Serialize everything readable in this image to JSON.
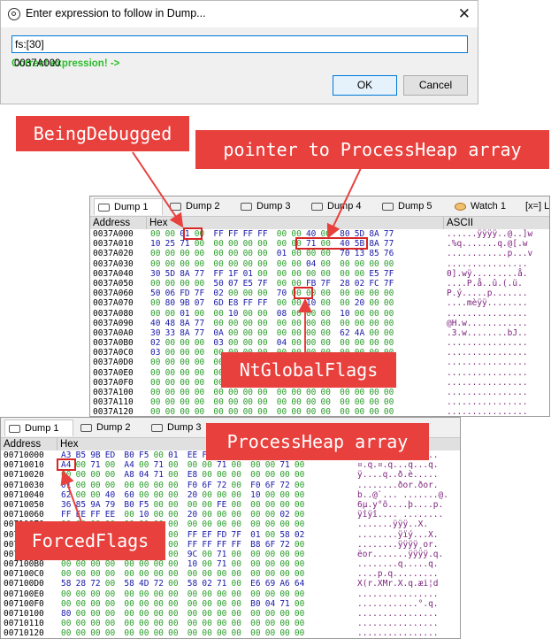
{
  "dialog": {
    "title": "Enter expression to follow in Dump...",
    "close_glyph": "✕",
    "expression_value": "fs:[30]",
    "status_ok": "Correct expression! ->",
    "status_address": "0037A000",
    "ok_label": "OK",
    "cancel_label": "Cancel"
  },
  "dump1": {
    "tabs": [
      "Dump 1",
      "Dump 2",
      "Dump 3",
      "Dump 4",
      "Dump 5",
      "Watch 1",
      "[x=] Lo"
    ],
    "headers": {
      "address": "Address",
      "hex": "Hex",
      "ascii": "ASCII"
    },
    "rows": [
      {
        "addr": "0037A000",
        "bytes": [
          "00",
          "00",
          "01",
          "00",
          "FF",
          "FF",
          "FF",
          "FF",
          "00",
          "00",
          "40",
          "00",
          "80",
          "5D",
          "8A",
          "77"
        ],
        "ascii": "......ÿÿÿÿ..@..]w"
      },
      {
        "addr": "0037A010",
        "bytes": [
          "10",
          "25",
          "71",
          "00",
          "00",
          "00",
          "00",
          "00",
          "00",
          "00",
          "71",
          "00",
          "40",
          "5B",
          "8A",
          "77"
        ],
        "ascii": ".%q.......q.@[.w"
      },
      {
        "addr": "0037A020",
        "bytes": [
          "00",
          "00",
          "00",
          "00",
          "00",
          "00",
          "00",
          "00",
          "01",
          "00",
          "00",
          "00",
          "70",
          "13",
          "85",
          "76"
        ],
        "ascii": "............p...v"
      },
      {
        "addr": "0037A030",
        "bytes": [
          "00",
          "00",
          "00",
          "00",
          "00",
          "00",
          "00",
          "00",
          "00",
          "00",
          "04",
          "00",
          "00",
          "00",
          "00",
          "00"
        ],
        "ascii": "................"
      },
      {
        "addr": "0037A040",
        "bytes": [
          "30",
          "5D",
          "8A",
          "77",
          "FF",
          "1F",
          "01",
          "00",
          "00",
          "00",
          "00",
          "00",
          "00",
          "00",
          "E5",
          "7F"
        ],
        "ascii": "0].wÿ.........å."
      },
      {
        "addr": "0037A050",
        "bytes": [
          "00",
          "00",
          "00",
          "00",
          "50",
          "07",
          "E5",
          "7F",
          "00",
          "00",
          "FB",
          "7F",
          "28",
          "02",
          "FC",
          "7F"
        ],
        "ascii": "....P.å..û.(.ü."
      },
      {
        "addr": "0037A060",
        "bytes": [
          "50",
          "06",
          "FD",
          "7F",
          "02",
          "00",
          "00",
          "00",
          "70",
          "00",
          "00",
          "00",
          "00",
          "00",
          "00",
          "00"
        ],
        "ascii": "P.ý.....p......."
      },
      {
        "addr": "0037A070",
        "bytes": [
          "00",
          "80",
          "9B",
          "07",
          "6D",
          "E8",
          "FF",
          "FF",
          "00",
          "00",
          "10",
          "00",
          "00",
          "20",
          "00",
          "00"
        ],
        "ascii": "....mèÿÿ........"
      },
      {
        "addr": "0037A080",
        "bytes": [
          "00",
          "00",
          "01",
          "00",
          "00",
          "10",
          "00",
          "00",
          "08",
          "00",
          "00",
          "00",
          "10",
          "00",
          "00",
          "00"
        ],
        "ascii": "................"
      },
      {
        "addr": "0037A090",
        "bytes": [
          "40",
          "48",
          "8A",
          "77",
          "00",
          "00",
          "00",
          "00",
          "00",
          "00",
          "00",
          "00",
          "00",
          "00",
          "00",
          "00"
        ],
        "ascii": "@H.w............"
      },
      {
        "addr": "0037A0A0",
        "bytes": [
          "30",
          "33",
          "8A",
          "77",
          "0A",
          "00",
          "00",
          "00",
          "00",
          "00",
          "00",
          "00",
          "62",
          "4A",
          "00",
          "00"
        ],
        "ascii": ".3.w........bJ.."
      },
      {
        "addr": "0037A0B0",
        "bytes": [
          "02",
          "00",
          "00",
          "00",
          "03",
          "00",
          "00",
          "00",
          "04",
          "00",
          "00",
          "00",
          "00",
          "00",
          "00",
          "00"
        ],
        "ascii": "................"
      },
      {
        "addr": "0037A0C0",
        "bytes": [
          "03",
          "00",
          "00",
          "00",
          "00",
          "00",
          "00",
          "00",
          "00",
          "00",
          "00",
          "00",
          "00",
          "00",
          "00",
          "00"
        ],
        "ascii": "................"
      },
      {
        "addr": "0037A0D0",
        "bytes": [
          "00",
          "00",
          "00",
          "00",
          "00",
          "00",
          "00",
          "00",
          "00",
          "00",
          "00",
          "00",
          "00",
          "00",
          "00",
          "00"
        ],
        "ascii": "................"
      },
      {
        "addr": "0037A0E0",
        "bytes": [
          "00",
          "00",
          "00",
          "00",
          "00",
          "00",
          "00",
          "00",
          "00",
          "00",
          "00",
          "00",
          "00",
          "00",
          "00",
          "00"
        ],
        "ascii": "................"
      },
      {
        "addr": "0037A0F0",
        "bytes": [
          "00",
          "00",
          "00",
          "00",
          "00",
          "00",
          "00",
          "00",
          "00",
          "00",
          "00",
          "00",
          "00",
          "00",
          "00",
          "00"
        ],
        "ascii": "................"
      },
      {
        "addr": "0037A100",
        "bytes": [
          "00",
          "00",
          "00",
          "00",
          "00",
          "00",
          "00",
          "00",
          "00",
          "00",
          "00",
          "00",
          "00",
          "00",
          "00",
          "00"
        ],
        "ascii": "................"
      },
      {
        "addr": "0037A110",
        "bytes": [
          "00",
          "00",
          "00",
          "00",
          "00",
          "00",
          "00",
          "00",
          "00",
          "00",
          "00",
          "00",
          "00",
          "00",
          "00",
          "00"
        ],
        "ascii": "................"
      },
      {
        "addr": "0037A120",
        "bytes": [
          "00",
          "00",
          "00",
          "00",
          "00",
          "00",
          "00",
          "00",
          "00",
          "00",
          "00",
          "00",
          "00",
          "00",
          "00",
          "00"
        ],
        "ascii": "................"
      }
    ]
  },
  "dump2": {
    "tabs": [
      "Dump 1",
      "Dump 2",
      "Dump 3"
    ],
    "headers": {
      "address": "Address",
      "hex": "Hex",
      "ascii": "Ll"
    },
    "rows": [
      {
        "addr": "00710000",
        "bytes": [
          "A3",
          "B5",
          "9B",
          "ED",
          "B0",
          "F5",
          "00",
          "01",
          "EE",
          "FF",
          "EE",
          "FF",
          "00",
          "00",
          "00",
          "00"
        ],
        "ascii": "£µ.í°õ..îÿîÿ...."
      },
      {
        "addr": "00710010",
        "bytes": [
          "A4",
          "00",
          "71",
          "00",
          "A4",
          "00",
          "71",
          "00",
          "00",
          "00",
          "71",
          "00",
          "00",
          "00",
          "71",
          "00"
        ],
        "ascii": "¤.q.¤.q...q...q."
      },
      {
        "addr": "00710020",
        "bytes": [
          "00",
          "00",
          "00",
          "00",
          "A8",
          "04",
          "71",
          "00",
          "E8",
          "00",
          "00",
          "00",
          "00",
          "00",
          "00",
          "00"
        ],
        "ascii": "ÿ....q..ð.è....."
      },
      {
        "addr": "00710030",
        "bytes": [
          "01",
          "00",
          "00",
          "00",
          "00",
          "00",
          "00",
          "00",
          "F0",
          "6F",
          "72",
          "00",
          "F0",
          "6F",
          "72",
          "00"
        ],
        "ascii": "........ðor.ðor."
      },
      {
        "addr": "00710040",
        "bytes": [
          "62",
          "00",
          "00",
          "40",
          "60",
          "00",
          "00",
          "00",
          "20",
          "00",
          "00",
          "00",
          "10",
          "00",
          "00",
          "00"
        ],
        "ascii": "b..@`... .......@."
      },
      {
        "addr": "00710050",
        "bytes": [
          "36",
          "85",
          "9A",
          "79",
          "B0",
          "F5",
          "00",
          "00",
          "00",
          "00",
          "FE",
          "00",
          "00",
          "00",
          "00",
          "00"
        ],
        "ascii": "6µ.y°õ....þ....p."
      },
      {
        "addr": "00710060",
        "bytes": [
          "FF",
          "EE",
          "FF",
          "EE",
          "00",
          "10",
          "00",
          "00",
          "20",
          "00",
          "00",
          "00",
          "00",
          "00",
          "02",
          "00"
        ],
        "ascii": "ÿîÿî.... ........"
      },
      {
        "addr": "00710070",
        "bytes": [
          "00",
          "00",
          "00",
          "00",
          "00",
          "00",
          "00",
          "00",
          "00",
          "00",
          "00",
          "00",
          "00",
          "00",
          "00",
          "00"
        ],
        "ascii": ".......ÿÿÿ..X."
      },
      {
        "addr": "00710080",
        "bytes": [
          "00",
          "00",
          "00",
          "00",
          "00",
          "00",
          "00",
          "00",
          "FF",
          "EF",
          "FD",
          "7F",
          "01",
          "00",
          "58",
          "02"
        ],
        "ascii": "........ÿïý...X."
      },
      {
        "addr": "00710090",
        "bytes": [
          "00",
          "00",
          "00",
          "00",
          "00",
          "00",
          "00",
          "00",
          "FF",
          "FF",
          "FF",
          "FF",
          "B8",
          "6F",
          "72",
          "00"
        ],
        "ascii": "........ÿÿÿÿ¸or."
      },
      {
        "addr": "007100A0",
        "bytes": [
          "00",
          "00",
          "00",
          "00",
          "00",
          "00",
          "00",
          "00",
          "9C",
          "00",
          "71",
          "00",
          "00",
          "00",
          "00",
          "00"
        ],
        "ascii": "ëor.......ÿÿÿÿ.q."
      },
      {
        "addr": "007100B0",
        "bytes": [
          "00",
          "00",
          "00",
          "00",
          "00",
          "00",
          "00",
          "00",
          "10",
          "00",
          "71",
          "00",
          "00",
          "00",
          "00",
          "00"
        ],
        "ascii": "........q.....q."
      },
      {
        "addr": "007100C0",
        "bytes": [
          "00",
          "00",
          "00",
          "00",
          "00",
          "00",
          "00",
          "00",
          "00",
          "00",
          "00",
          "00",
          "00",
          "00",
          "00",
          "00"
        ],
        "ascii": "....p.q........."
      },
      {
        "addr": "007100D0",
        "bytes": [
          "58",
          "28",
          "72",
          "00",
          "58",
          "4D",
          "72",
          "00",
          "58",
          "02",
          "71",
          "00",
          "E6",
          "69",
          "A6",
          "64"
        ],
        "ascii": "X(r.XMr.X.q.æi¦d"
      },
      {
        "addr": "007100E0",
        "bytes": [
          "00",
          "00",
          "00",
          "00",
          "00",
          "00",
          "00",
          "00",
          "00",
          "00",
          "00",
          "00",
          "00",
          "00",
          "00",
          "00"
        ],
        "ascii": "................"
      },
      {
        "addr": "007100F0",
        "bytes": [
          "00",
          "00",
          "00",
          "00",
          "00",
          "00",
          "00",
          "00",
          "00",
          "00",
          "00",
          "00",
          "B0",
          "04",
          "71",
          "00"
        ],
        "ascii": "............°.q."
      },
      {
        "addr": "00710100",
        "bytes": [
          "80",
          "00",
          "00",
          "00",
          "00",
          "00",
          "00",
          "00",
          "00",
          "00",
          "00",
          "00",
          "00",
          "00",
          "00",
          "00"
        ],
        "ascii": "................"
      },
      {
        "addr": "00710110",
        "bytes": [
          "00",
          "00",
          "00",
          "00",
          "00",
          "00",
          "00",
          "00",
          "00",
          "00",
          "00",
          "00",
          "00",
          "00",
          "00",
          "00"
        ],
        "ascii": "................"
      },
      {
        "addr": "00710120",
        "bytes": [
          "00",
          "00",
          "00",
          "00",
          "00",
          "00",
          "00",
          "00",
          "00",
          "00",
          "00",
          "00",
          "00",
          "00",
          "00",
          "00"
        ],
        "ascii": "................"
      }
    ]
  },
  "callouts": {
    "being_debugged": "BeingDebugged",
    "pointer_to_heap": "pointer to ProcessHeap array",
    "nt_global_flags": "NtGlobalFlags",
    "process_heap_array": "ProcessHeap array",
    "forced_flags": "ForcedFlags"
  },
  "colors": {
    "callout": "#e8403d",
    "highlight": "#d72626",
    "ok_text": "#2ebd2e",
    "zero_byte": "#2a9d2a",
    "nonzero_byte": "#1a1aa8",
    "ascii_text": "#7a1e7a"
  }
}
